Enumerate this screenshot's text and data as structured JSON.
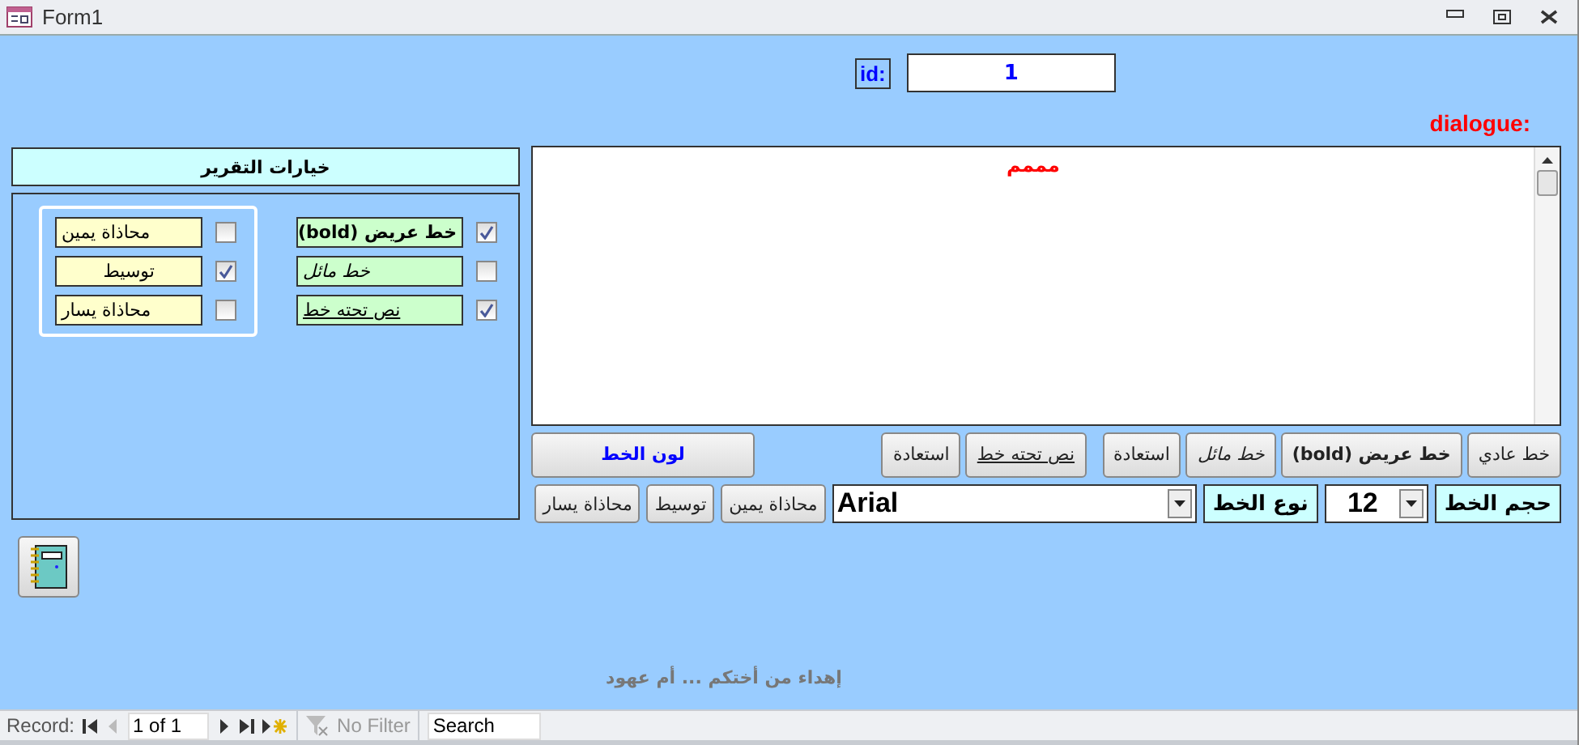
{
  "window": {
    "title": "Form1"
  },
  "id_field": {
    "label": "id:",
    "value": "1"
  },
  "dialogue": {
    "label": "dialogue:",
    "value": "مممم"
  },
  "report_options": {
    "title": "خيارات التقرير",
    "alignment_options": [
      {
        "label": "محاذاة يمين",
        "kind": "right",
        "checked": false
      },
      {
        "label": "توسيط",
        "kind": "center",
        "checked": true
      },
      {
        "label": "محاذاة يسار",
        "kind": "left",
        "checked": false
      }
    ],
    "style_options": [
      {
        "label": "خط عريض (bold)",
        "kind": "bold",
        "checked": true
      },
      {
        "label": "خط مائل",
        "kind": "italic",
        "checked": false
      },
      {
        "label": "نص تحته خط",
        "kind": "underline",
        "checked": true
      }
    ]
  },
  "style_buttons": [
    {
      "label": "خط عادي",
      "kind": "plain"
    },
    {
      "label": "خط عريض (bold)",
      "kind": "bold"
    },
    {
      "label": "خط مائل",
      "kind": "italic"
    },
    {
      "label": "استعادة",
      "kind": "restore"
    },
    {
      "label": "نص تحته خط",
      "kind": "underline"
    },
    {
      "label": "استعادة",
      "kind": "restore"
    }
  ],
  "color_button": {
    "label": "لون الخط"
  },
  "font_size": {
    "label": "حجم الخط",
    "value": "12"
  },
  "font_name": {
    "label": "نوع الخط",
    "value": "Arial"
  },
  "alignment_buttons": [
    {
      "label": "محاذاة يمين"
    },
    {
      "label": "توسيط"
    },
    {
      "label": "محاذاة يسار"
    }
  ],
  "dedication": "إهداء من أختكم ... أم عهود",
  "record_nav": {
    "label": "Record:",
    "position": "1 of 1",
    "filter": "No Filter",
    "search_placeholder": "Search"
  }
}
